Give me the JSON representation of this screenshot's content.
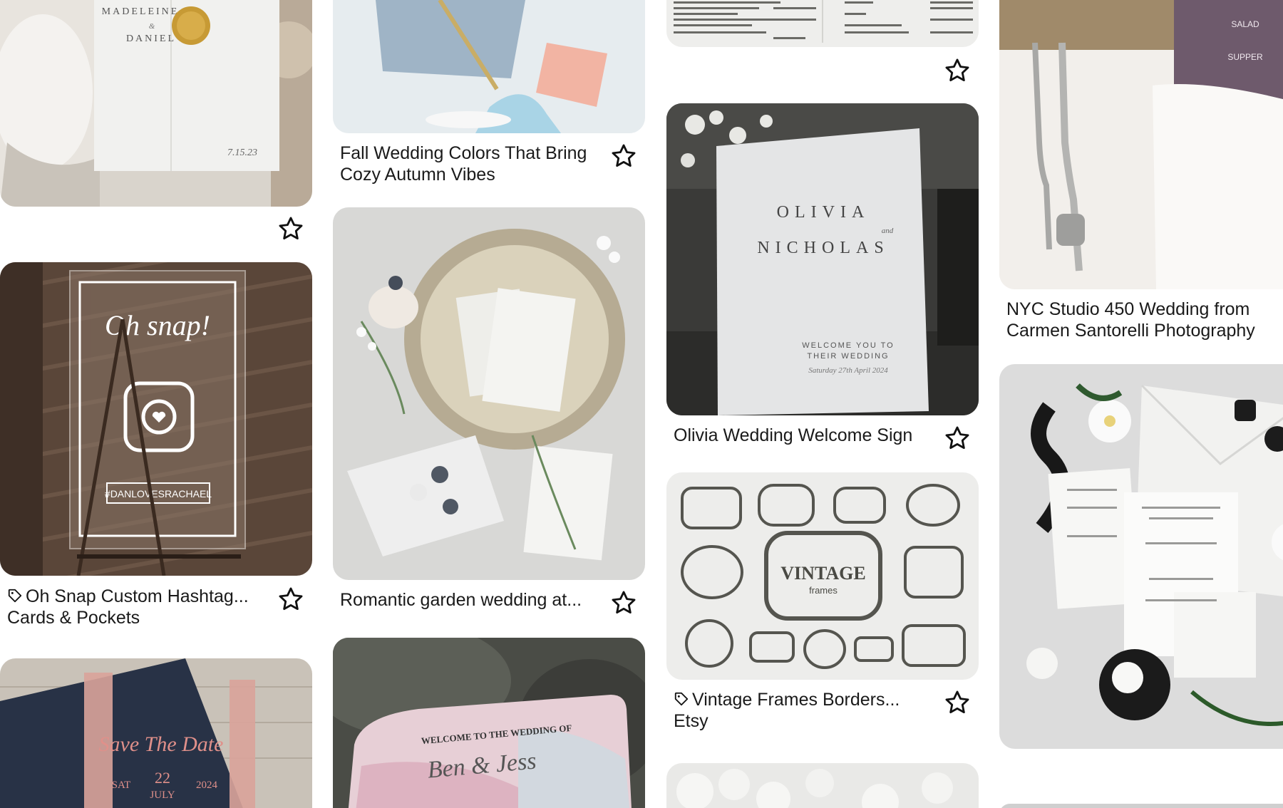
{
  "cards": {
    "c1": {
      "image_text": {
        "name1": "MADELEINE",
        "and": "&",
        "name2": "DANIEL",
        "date": "7.15.23"
      }
    },
    "c2": {
      "title_line1": "Oh Snap Custom Hashtag...",
      "subtitle": "Cards & Pockets",
      "image_text": {
        "headline": "Oh snap!",
        "caption": "#DANLOVESRACHAEL"
      }
    },
    "c3": {
      "image_text": {
        "headline": "Save The Date",
        "day": "SAT",
        "date": "22",
        "month": "JULY",
        "year": "2024"
      }
    },
    "c4": {
      "title_line1": "Fall Wedding Colors That Bring",
      "title_line2": "Cozy Autumn Vibes"
    },
    "c5": {
      "title": "Romantic garden wedding at..."
    },
    "c6": {
      "image_text": {
        "line1": "WELCOME TO THE WEDDING OF",
        "names": "Ben & Jess"
      }
    },
    "c7": {},
    "c8": {
      "title": "Olivia Wedding Welcome Sign",
      "image_text": {
        "name1": "OLIVIA",
        "and": "and",
        "name2": "NICHOLAS",
        "welcome": "WELCOME YOU TO",
        "their": "THEIR WEDDING",
        "date": "Saturday 27th April 2024"
      }
    },
    "c9": {
      "title": "Vintage Frames Borders...",
      "subtitle": "Etsy",
      "image_text": {
        "headline": "VINTAGE",
        "sub": "frames"
      }
    },
    "c10": {},
    "c11": {
      "title_line1": "NYC Studio 450 Wedding from",
      "title_line2": "Carmen Santorelli Photography",
      "image_text": {
        "salad": "SALAD",
        "supper": "SUPPER"
      }
    },
    "c12": {}
  },
  "colors": {
    "text": "#1a1a1a",
    "star_stroke": "#111111",
    "background": "#ffffff"
  },
  "icons": {
    "save": "star-outline-icon",
    "tag": "tag-icon"
  }
}
